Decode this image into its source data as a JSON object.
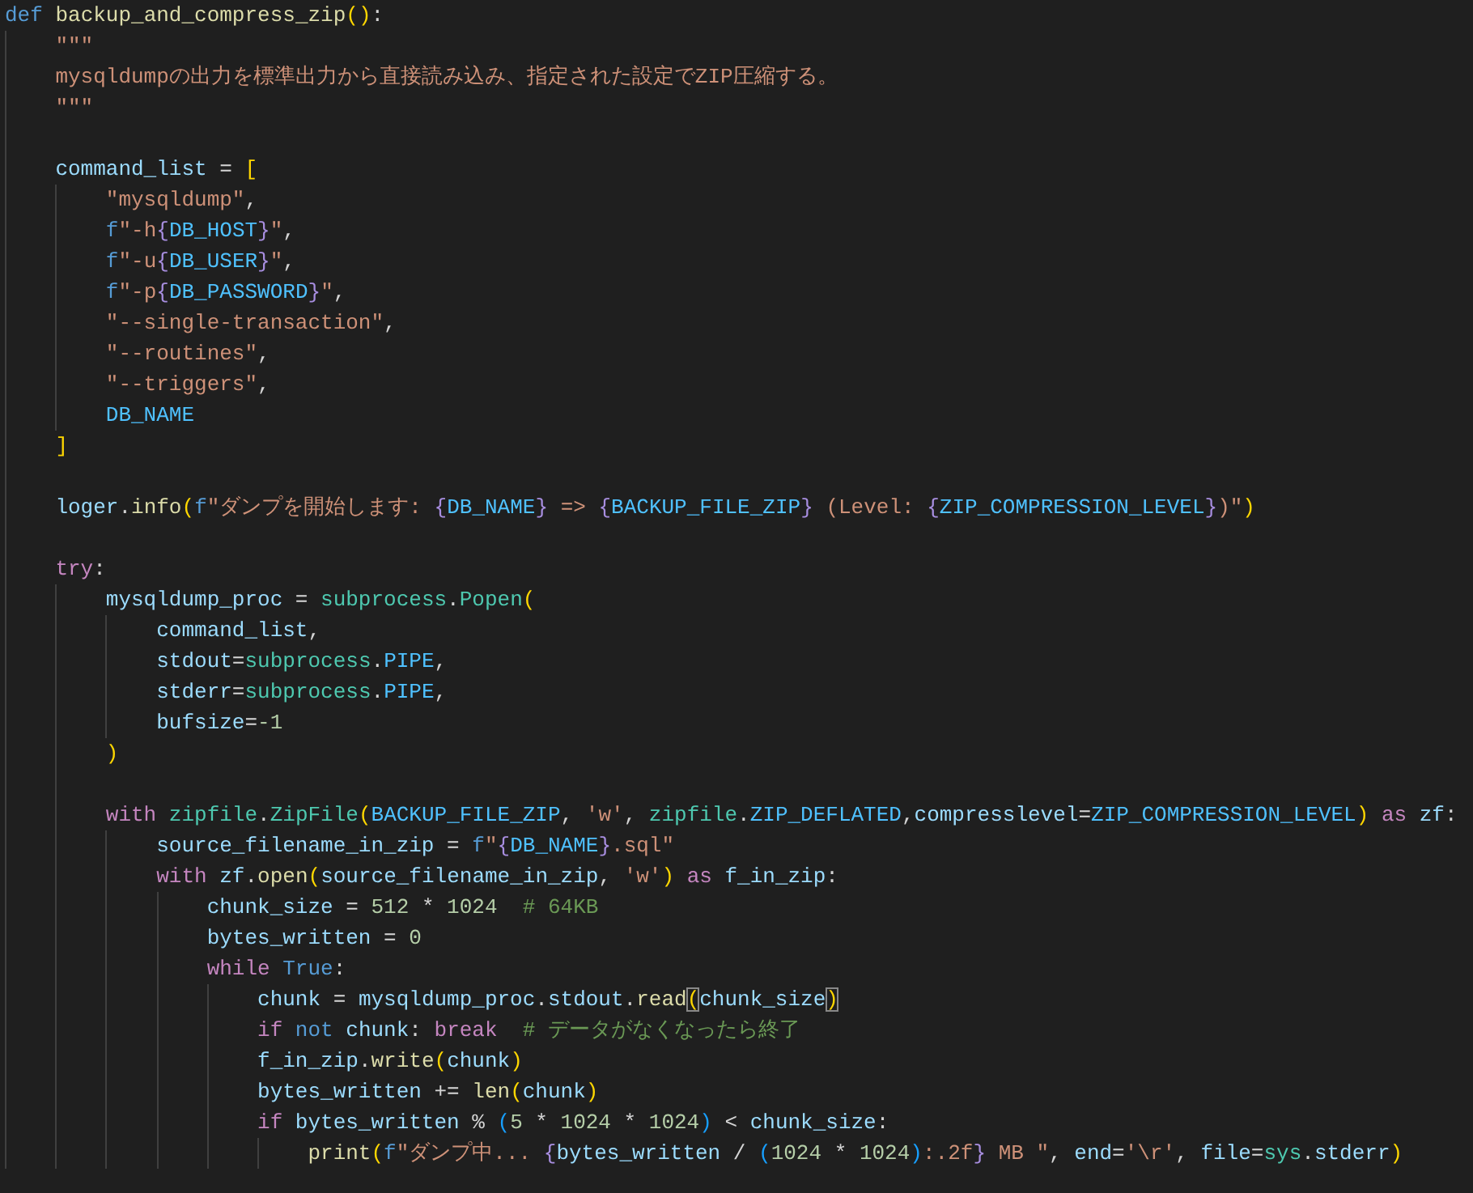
{
  "editor": {
    "lines": [
      {
        "tokens": [
          {
            "kind": "storage",
            "text": "def "
          },
          {
            "kind": "function",
            "text": "backup_and_compress_zip"
          },
          {
            "kind": "bracket1",
            "text": "()"
          },
          {
            "kind": "plain",
            "text": ":"
          }
        ]
      },
      {
        "tokens": [
          {
            "kind": "string",
            "text": "    \"\"\""
          }
        ]
      },
      {
        "tokens": [
          {
            "kind": "string",
            "text": "    mysqldumpの出力を標準出力から直接読み込み、指定された設定でZIP圧縮する。"
          }
        ]
      },
      {
        "tokens": [
          {
            "kind": "string",
            "text": "    \"\"\""
          }
        ]
      },
      {
        "gap_before": true,
        "tokens": [
          {
            "kind": "variable",
            "text": "    command_list"
          },
          {
            "kind": "plain",
            "text": " = "
          },
          {
            "kind": "bracket1",
            "text": "["
          }
        ]
      },
      {
        "tokens": [
          {
            "kind": "string",
            "text": "        \"mysqldump\""
          },
          {
            "kind": "plain",
            "text": ","
          }
        ]
      },
      {
        "tokens": [
          {
            "kind": "storage",
            "text": "        f"
          },
          {
            "kind": "string",
            "text": "\"-h"
          },
          {
            "kind": "brace",
            "text": "{"
          },
          {
            "kind": "constant",
            "text": "DB_HOST"
          },
          {
            "kind": "brace",
            "text": "}"
          },
          {
            "kind": "string",
            "text": "\""
          },
          {
            "kind": "plain",
            "text": ","
          }
        ]
      },
      {
        "tokens": [
          {
            "kind": "storage",
            "text": "        f"
          },
          {
            "kind": "string",
            "text": "\"-u"
          },
          {
            "kind": "brace",
            "text": "{"
          },
          {
            "kind": "constant",
            "text": "DB_USER"
          },
          {
            "kind": "brace",
            "text": "}"
          },
          {
            "kind": "string",
            "text": "\""
          },
          {
            "kind": "plain",
            "text": ","
          }
        ]
      },
      {
        "tokens": [
          {
            "kind": "storage",
            "text": "        f"
          },
          {
            "kind": "string",
            "text": "\"-p"
          },
          {
            "kind": "brace",
            "text": "{"
          },
          {
            "kind": "constant",
            "text": "DB_PASSWORD"
          },
          {
            "kind": "brace",
            "text": "}"
          },
          {
            "kind": "string",
            "text": "\""
          },
          {
            "kind": "plain",
            "text": ","
          }
        ]
      },
      {
        "tokens": [
          {
            "kind": "string",
            "text": "        \"--single-transaction\""
          },
          {
            "kind": "plain",
            "text": ","
          }
        ]
      },
      {
        "tokens": [
          {
            "kind": "string",
            "text": "        \"--routines\""
          },
          {
            "kind": "plain",
            "text": ","
          }
        ]
      },
      {
        "tokens": [
          {
            "kind": "string",
            "text": "        \"--triggers\""
          },
          {
            "kind": "plain",
            "text": ","
          }
        ]
      },
      {
        "tokens": [
          {
            "kind": "constant",
            "text": "        DB_NAME"
          }
        ]
      },
      {
        "tokens": [
          {
            "kind": "bracket1",
            "text": "    ]"
          }
        ]
      },
      {
        "gap_before": true,
        "tokens": [
          {
            "kind": "variable",
            "text": "    loger"
          },
          {
            "kind": "plain",
            "text": "."
          },
          {
            "kind": "function",
            "text": "info"
          },
          {
            "kind": "bracket1",
            "text": "("
          },
          {
            "kind": "storage",
            "text": "f"
          },
          {
            "kind": "string",
            "text": "\"ダンプを開始します: "
          },
          {
            "kind": "brace",
            "text": "{"
          },
          {
            "kind": "constant",
            "text": "DB_NAME"
          },
          {
            "kind": "brace",
            "text": "}"
          },
          {
            "kind": "string",
            "text": " => "
          },
          {
            "kind": "brace",
            "text": "{"
          },
          {
            "kind": "constant",
            "text": "BACKUP_FILE_ZIP"
          },
          {
            "kind": "brace",
            "text": "}"
          },
          {
            "kind": "string",
            "text": " (Level: "
          },
          {
            "kind": "brace",
            "text": "{"
          },
          {
            "kind": "constant",
            "text": "ZIP_COMPRESSION_LEVEL"
          },
          {
            "kind": "brace",
            "text": "}"
          },
          {
            "kind": "string",
            "text": ")\""
          },
          {
            "kind": "bracket1",
            "text": ")"
          }
        ]
      },
      {
        "gap_before": true,
        "tokens": [
          {
            "kind": "keyword",
            "text": "    try"
          },
          {
            "kind": "plain",
            "text": ":"
          }
        ]
      },
      {
        "tokens": [
          {
            "kind": "variable",
            "text": "        mysqldump_proc"
          },
          {
            "kind": "plain",
            "text": " = "
          },
          {
            "kind": "class",
            "text": "subprocess"
          },
          {
            "kind": "plain",
            "text": "."
          },
          {
            "kind": "class",
            "text": "Popen"
          },
          {
            "kind": "bracket1",
            "text": "("
          }
        ]
      },
      {
        "tokens": [
          {
            "kind": "variable",
            "text": "            command_list"
          },
          {
            "kind": "plain",
            "text": ","
          }
        ]
      },
      {
        "tokens": [
          {
            "kind": "variable",
            "text": "            stdout"
          },
          {
            "kind": "plain",
            "text": "="
          },
          {
            "kind": "class",
            "text": "subprocess"
          },
          {
            "kind": "plain",
            "text": "."
          },
          {
            "kind": "constant",
            "text": "PIPE"
          },
          {
            "kind": "plain",
            "text": ","
          }
        ]
      },
      {
        "tokens": [
          {
            "kind": "variable",
            "text": "            stderr"
          },
          {
            "kind": "plain",
            "text": "="
          },
          {
            "kind": "class",
            "text": "subprocess"
          },
          {
            "kind": "plain",
            "text": "."
          },
          {
            "kind": "constant",
            "text": "PIPE"
          },
          {
            "kind": "plain",
            "text": ","
          }
        ]
      },
      {
        "tokens": [
          {
            "kind": "variable",
            "text": "            bufsize"
          },
          {
            "kind": "plain",
            "text": "="
          },
          {
            "kind": "number",
            "text": "-1"
          }
        ]
      },
      {
        "tokens": [
          {
            "kind": "bracket1",
            "text": "        )"
          }
        ]
      },
      {
        "gap_before": true,
        "tokens": [
          {
            "kind": "keyword",
            "text": "        with "
          },
          {
            "kind": "class",
            "text": "zipfile"
          },
          {
            "kind": "plain",
            "text": "."
          },
          {
            "kind": "class",
            "text": "ZipFile"
          },
          {
            "kind": "bracket1",
            "text": "("
          },
          {
            "kind": "constant",
            "text": "BACKUP_FILE_ZIP"
          },
          {
            "kind": "plain",
            "text": ", "
          },
          {
            "kind": "string",
            "text": "'w'"
          },
          {
            "kind": "plain",
            "text": ", "
          },
          {
            "kind": "class",
            "text": "zipfile"
          },
          {
            "kind": "plain",
            "text": "."
          },
          {
            "kind": "constant",
            "text": "ZIP_DEFLATED"
          },
          {
            "kind": "plain",
            "text": ","
          },
          {
            "kind": "variable",
            "text": "compresslevel"
          },
          {
            "kind": "plain",
            "text": "="
          },
          {
            "kind": "constant",
            "text": "ZIP_COMPRESSION_LEVEL"
          },
          {
            "kind": "bracket1",
            "text": ")"
          },
          {
            "kind": "keyword",
            "text": " as"
          },
          {
            "kind": "variable",
            "text": " zf"
          },
          {
            "kind": "plain",
            "text": ":"
          }
        ]
      },
      {
        "tokens": [
          {
            "kind": "variable",
            "text": "            source_filename_in_zip"
          },
          {
            "kind": "plain",
            "text": " = "
          },
          {
            "kind": "storage",
            "text": "f"
          },
          {
            "kind": "string",
            "text": "\""
          },
          {
            "kind": "brace",
            "text": "{"
          },
          {
            "kind": "constant",
            "text": "DB_NAME"
          },
          {
            "kind": "brace",
            "text": "}"
          },
          {
            "kind": "string",
            "text": ".sql\""
          }
        ]
      },
      {
        "tokens": [
          {
            "kind": "keyword",
            "text": "            with "
          },
          {
            "kind": "variable",
            "text": "zf"
          },
          {
            "kind": "plain",
            "text": "."
          },
          {
            "kind": "function",
            "text": "open"
          },
          {
            "kind": "bracket1",
            "text": "("
          },
          {
            "kind": "variable",
            "text": "source_filename_in_zip"
          },
          {
            "kind": "plain",
            "text": ", "
          },
          {
            "kind": "string",
            "text": "'w'"
          },
          {
            "kind": "bracket1",
            "text": ")"
          },
          {
            "kind": "keyword",
            "text": " as"
          },
          {
            "kind": "variable",
            "text": " f_in_zip"
          },
          {
            "kind": "plain",
            "text": ":"
          }
        ]
      },
      {
        "tokens": [
          {
            "kind": "variable",
            "text": "                chunk_size"
          },
          {
            "kind": "plain",
            "text": " = "
          },
          {
            "kind": "number",
            "text": "512"
          },
          {
            "kind": "plain",
            "text": " * "
          },
          {
            "kind": "number",
            "text": "1024"
          },
          {
            "kind": "comment",
            "text": "  # 64KB"
          }
        ]
      },
      {
        "tokens": [
          {
            "kind": "variable",
            "text": "                bytes_written"
          },
          {
            "kind": "plain",
            "text": " = "
          },
          {
            "kind": "number",
            "text": "0"
          }
        ]
      },
      {
        "tokens": [
          {
            "kind": "keyword",
            "text": "                while "
          },
          {
            "kind": "storage",
            "text": "True"
          },
          {
            "kind": "plain",
            "text": ":"
          }
        ]
      },
      {
        "tokens": [
          {
            "kind": "variable",
            "text": "                    chunk"
          },
          {
            "kind": "plain",
            "text": " = "
          },
          {
            "kind": "variable",
            "text": "mysqldump_proc"
          },
          {
            "kind": "plain",
            "text": "."
          },
          {
            "kind": "variable",
            "text": "stdout"
          },
          {
            "kind": "plain",
            "text": "."
          },
          {
            "kind": "function",
            "text": "read"
          },
          {
            "kind": "match",
            "text": "("
          },
          {
            "kind": "variable",
            "text": "chunk_size"
          },
          {
            "kind": "match",
            "text": ")"
          }
        ]
      },
      {
        "tokens": [
          {
            "kind": "keyword",
            "text": "                    if "
          },
          {
            "kind": "storage",
            "text": "not "
          },
          {
            "kind": "variable",
            "text": "chunk"
          },
          {
            "kind": "plain",
            "text": ": "
          },
          {
            "kind": "keyword",
            "text": "break"
          },
          {
            "kind": "comment",
            "text": "  # データがなくなったら終了"
          }
        ]
      },
      {
        "tokens": [
          {
            "kind": "variable",
            "text": "                    f_in_zip"
          },
          {
            "kind": "plain",
            "text": "."
          },
          {
            "kind": "function",
            "text": "write"
          },
          {
            "kind": "bracket1",
            "text": "("
          },
          {
            "kind": "variable",
            "text": "chunk"
          },
          {
            "kind": "bracket1",
            "text": ")"
          }
        ]
      },
      {
        "tokens": [
          {
            "kind": "variable",
            "text": "                    bytes_written"
          },
          {
            "kind": "plain",
            "text": " += "
          },
          {
            "kind": "function",
            "text": "len"
          },
          {
            "kind": "bracket1",
            "text": "("
          },
          {
            "kind": "variable",
            "text": "chunk"
          },
          {
            "kind": "bracket1",
            "text": ")"
          }
        ]
      },
      {
        "tokens": [
          {
            "kind": "keyword",
            "text": "                    if "
          },
          {
            "kind": "variable",
            "text": "bytes_written"
          },
          {
            "kind": "plain",
            "text": " % "
          },
          {
            "kind": "bracket3",
            "text": "("
          },
          {
            "kind": "number",
            "text": "5"
          },
          {
            "kind": "plain",
            "text": " * "
          },
          {
            "kind": "number",
            "text": "1024"
          },
          {
            "kind": "plain",
            "text": " * "
          },
          {
            "kind": "number",
            "text": "1024"
          },
          {
            "kind": "bracket3",
            "text": ")"
          },
          {
            "kind": "plain",
            "text": " < "
          },
          {
            "kind": "variable",
            "text": "chunk_size"
          },
          {
            "kind": "plain",
            "text": ":"
          }
        ]
      },
      {
        "tokens": [
          {
            "kind": "function",
            "text": "                        print"
          },
          {
            "kind": "bracket1",
            "text": "("
          },
          {
            "kind": "storage",
            "text": "f"
          },
          {
            "kind": "string",
            "text": "\"ダンプ中... "
          },
          {
            "kind": "brace",
            "text": "{"
          },
          {
            "kind": "variable",
            "text": "bytes_written"
          },
          {
            "kind": "plain",
            "text": " / "
          },
          {
            "kind": "bracket3",
            "text": "("
          },
          {
            "kind": "number",
            "text": "1024"
          },
          {
            "kind": "plain",
            "text": " * "
          },
          {
            "kind": "number",
            "text": "1024"
          },
          {
            "kind": "bracket3",
            "text": ")"
          },
          {
            "kind": "string",
            "text": ":.2f"
          },
          {
            "kind": "brace",
            "text": "}"
          },
          {
            "kind": "string",
            "text": " MB \""
          },
          {
            "kind": "plain",
            "text": ", "
          },
          {
            "kind": "variable",
            "text": "end"
          },
          {
            "kind": "plain",
            "text": "="
          },
          {
            "kind": "string",
            "text": "'\\r'"
          },
          {
            "kind": "plain",
            "text": ", "
          },
          {
            "kind": "variable",
            "text": "file"
          },
          {
            "kind": "plain",
            "text": "="
          },
          {
            "kind": "class",
            "text": "sys"
          },
          {
            "kind": "plain",
            "text": "."
          },
          {
            "kind": "variable",
            "text": "stderr"
          },
          {
            "kind": "bracket1",
            "text": ")"
          }
        ]
      }
    ]
  }
}
